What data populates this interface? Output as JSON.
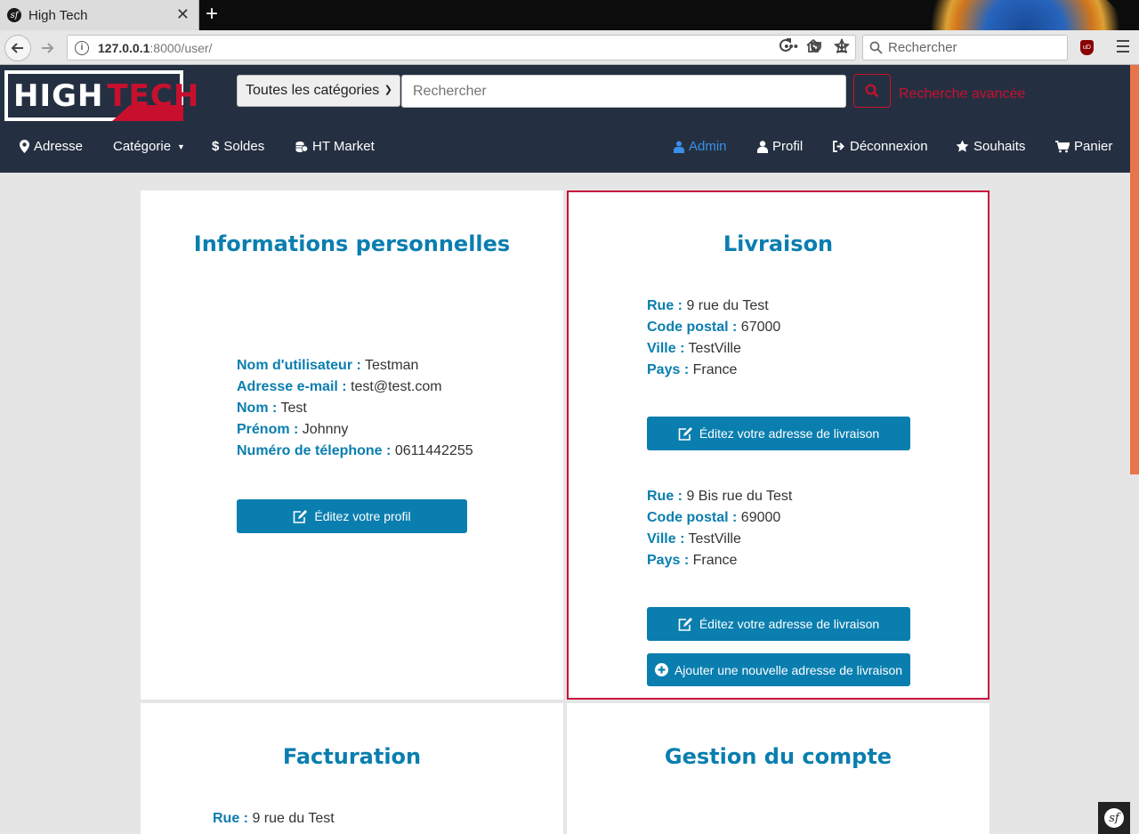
{
  "browser": {
    "tab_title": "High Tech",
    "url_host": "127.0.0.1",
    "url_rest": ":8000/user/",
    "search_placeholder": "Rechercher",
    "ublock_label": "uD"
  },
  "header": {
    "logo_high": "HIGH",
    "logo_tech": "TECH",
    "category_select": "Toutes les catégories",
    "search_placeholder": "Rechercher",
    "advanced_search": "Recherche avancée"
  },
  "nav": {
    "left": [
      {
        "label": "Adresse",
        "icon": "map-marker-icon"
      },
      {
        "label": "Catégorie",
        "icon": "caret-down-icon"
      },
      {
        "label": "Soldes",
        "icon": "dollar-icon"
      },
      {
        "label": "HT Market",
        "icon": "coins-icon"
      }
    ],
    "right": [
      {
        "label": "Admin",
        "icon": "users-icon"
      },
      {
        "label": "Profil",
        "icon": "user-icon"
      },
      {
        "label": "Déconnexion",
        "icon": "sign-out-icon"
      },
      {
        "label": "Souhaits",
        "icon": "star-icon"
      },
      {
        "label": "Panier",
        "icon": "cart-icon"
      }
    ]
  },
  "colors": {
    "accent": "#0a7eaf",
    "brand_red": "#c8102e",
    "header_bg": "#243041",
    "admin_active": "#3a8fe8"
  },
  "personal": {
    "title": "Informations personnelles",
    "fields": [
      {
        "label": "Nom d'utilisateur :",
        "value": "Testman"
      },
      {
        "label": "Adresse e-mail :",
        "value": "test@test.com"
      },
      {
        "label": "Nom :",
        "value": "Test"
      },
      {
        "label": "Prénom :",
        "value": "Johnny"
      },
      {
        "label": "Numéro de télephone :",
        "value": "0611442255"
      }
    ],
    "edit_button": "Éditez votre profil"
  },
  "delivery": {
    "title": "Livraison",
    "addresses": [
      {
        "fields": [
          {
            "label": "Rue :",
            "value": "9 rue du Test"
          },
          {
            "label": "Code postal :",
            "value": "67000"
          },
          {
            "label": "Ville :",
            "value": "TestVille"
          },
          {
            "label": "Pays :",
            "value": "France"
          }
        ]
      },
      {
        "fields": [
          {
            "label": "Rue :",
            "value": "9 Bis rue du Test"
          },
          {
            "label": "Code postal :",
            "value": "69000"
          },
          {
            "label": "Ville :",
            "value": "TestVille"
          },
          {
            "label": "Pays :",
            "value": "France"
          }
        ]
      }
    ],
    "edit_button": "Éditez votre adresse de livraison",
    "add_button": "Ajouter une nouvelle adresse de livraison"
  },
  "billing": {
    "title": "Facturation",
    "fields": [
      {
        "label": "Rue :",
        "value": "9 rue du Test"
      }
    ]
  },
  "account": {
    "title": "Gestion du compte"
  }
}
